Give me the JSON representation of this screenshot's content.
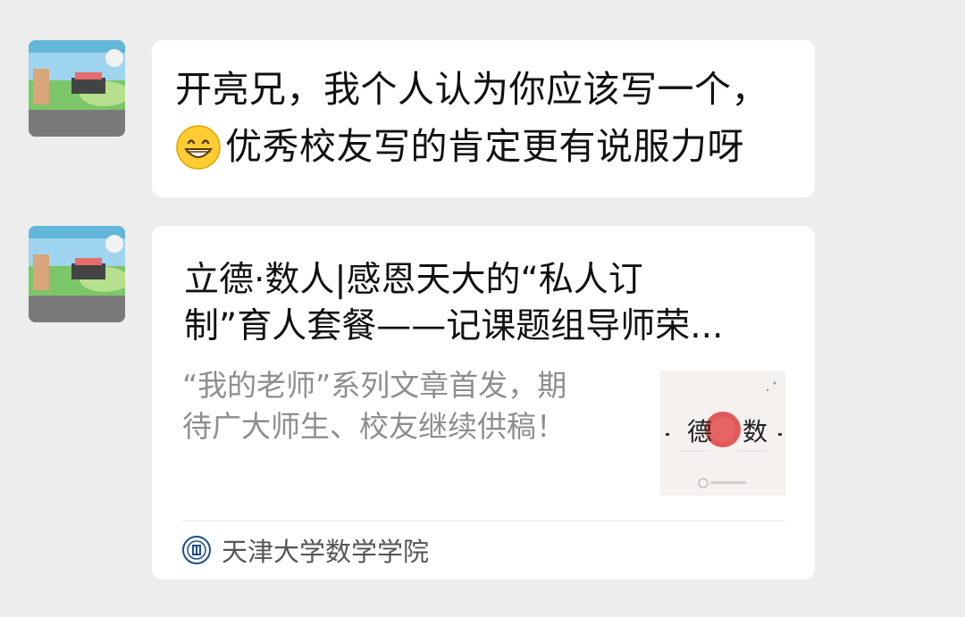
{
  "messages": {
    "first": {
      "line1": "开亮兄，我个人认为你应该写一个，",
      "line2": "优秀校友写的肯定更有说服力呀",
      "emoji": "grinning-face-icon"
    },
    "card": {
      "title_line1": "立德·数人|感恩天大的“私人订",
      "title_line2": "制”育人套餐——记课题组导师荣...",
      "desc_line1": "“我的老师”系列文章首发，期",
      "desc_line2": "待广大师生、校友继续供稿！",
      "thumb_char_left": "德",
      "thumb_char_right": "数",
      "source_name": "天津大学数学学院"
    }
  },
  "colors": {
    "background": "#ededed",
    "bubble": "#ffffff",
    "text": "#111111",
    "desc": "#8e8e8e",
    "thumb_seal": "#e04848"
  }
}
